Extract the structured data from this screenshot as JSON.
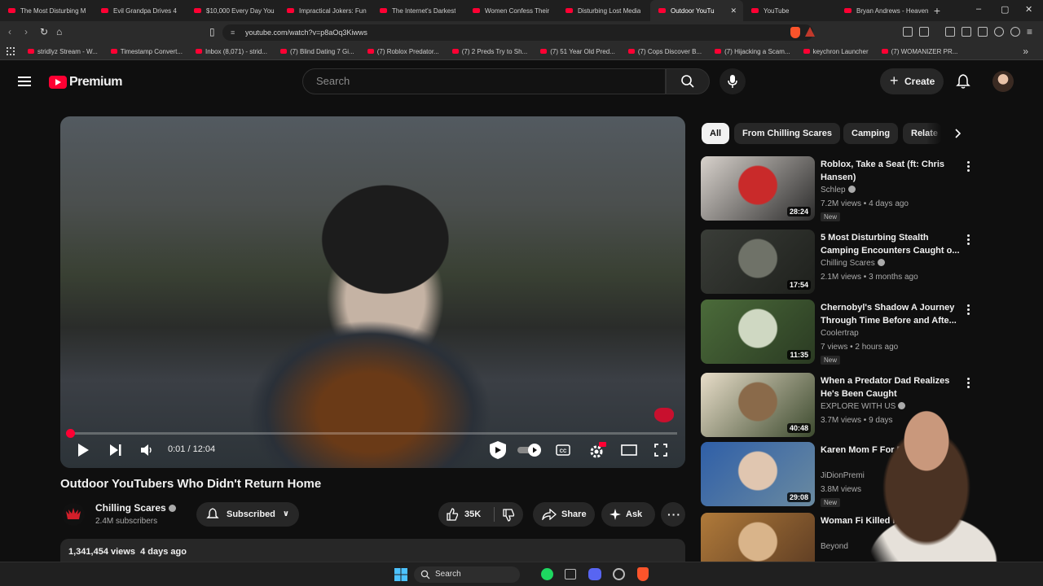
{
  "browser": {
    "tabs": [
      {
        "label": "The Most Disturbing M",
        "active": false
      },
      {
        "label": "Evil Grandpa Drives 4",
        "active": false
      },
      {
        "label": "$10,000 Every Day You",
        "active": false
      },
      {
        "label": "Impractical Jokers: Fun",
        "active": false
      },
      {
        "label": "The Internet's Darkest",
        "active": false
      },
      {
        "label": "Women Confess Their",
        "active": false
      },
      {
        "label": "Disturbing Lost Media",
        "active": false
      },
      {
        "label": "Outdoor YouTu",
        "active": true
      },
      {
        "label": "YouTube",
        "active": false
      },
      {
        "label": "Bryan Andrews - Heaven",
        "active": false
      }
    ],
    "url": "youtube.com/watch?v=p8aOq3Kiwws",
    "bookmarks": [
      "stridlyz Stream - W...",
      "Timestamp Convert...",
      "Inbox (8,071) - strid...",
      "(7) Blind Dating 7 Gi...",
      "(7) Roblox Predator...",
      "(7) 2 Preds Try to Sh...",
      "(7) 51 Year Old Pred...",
      "(7) Cops Discover B...",
      "(7) Hijacking a Scam...",
      "keychron Launcher",
      "(7) WOMANIZER PR..."
    ]
  },
  "header": {
    "logo_text": "Premium",
    "search_placeholder": "Search",
    "create_label": "Create"
  },
  "player": {
    "time": "0:01 / 12:04",
    "progress": 0.0014,
    "watermark_color": "#c8102e"
  },
  "video": {
    "title": "Outdoor YouTubers Who Didn't Return Home",
    "channel": "Chilling Scares",
    "subscribers": "2.4M subscribers",
    "subscribed_label": "Subscribed",
    "likes": "35K",
    "share_label": "Share",
    "ask_label": "Ask",
    "views": "1,341,454 views",
    "posted": "4 days ago"
  },
  "chips": [
    {
      "label": "All",
      "active": true
    },
    {
      "label": "From Chilling Scares",
      "active": false
    },
    {
      "label": "Camping",
      "active": false
    },
    {
      "label": "Relate",
      "active": false
    }
  ],
  "recommendations": [
    {
      "title": "Roblox, Take a Seat (ft: Chris Hansen)",
      "channel": "Schlep",
      "verified": true,
      "meta": "7.2M views • 4 days ago",
      "badge": "New",
      "duration": "28:24",
      "thumb_colors": [
        "#d8d2cc",
        "#c92a2a",
        "#2b2b2b"
      ]
    },
    {
      "title": "5 Most Disturbing Stealth Camping Encounters Caught o...",
      "channel": "Chilling Scares",
      "verified": true,
      "meta": "2.1M views • 3 months ago",
      "badge": "",
      "duration": "17:54",
      "thumb_colors": [
        "#3a3d38",
        "#6f7268",
        "#1e201c"
      ]
    },
    {
      "title": "Chernobyl's Shadow  A Journey Through Time Before and Afte...",
      "channel": "Coolertrap",
      "verified": false,
      "meta": "7 views • 2 hours ago",
      "badge": "New",
      "duration": "11:35",
      "thumb_colors": [
        "#4b6b3a",
        "#cfd8c2",
        "#2a3a22"
      ]
    },
    {
      "title": "When a Predator Dad Realizes He's Been Caught",
      "channel": "EXPLORE WITH US",
      "verified": true,
      "meta": "3.7M views • 9 days",
      "badge": "",
      "duration": "40:48",
      "thumb_colors": [
        "#e8ddc9",
        "#8a6a4a",
        "#3c4a2e"
      ]
    },
    {
      "title": "Karen Mom F For EXPOS",
      "channel": "JiDionPremi",
      "verified": false,
      "meta": "3.8M views",
      "badge": "New",
      "duration": "29:08",
      "thumb_colors": [
        "#2f5fa8",
        "#e0c6b0",
        "#6a8aa0"
      ]
    },
    {
      "title": "Woman Fi Killed H",
      "channel": "Beyond",
      "verified": false,
      "meta": "",
      "badge": "",
      "duration": "",
      "thumb_colors": [
        "#b07a3a",
        "#d9b48a",
        "#5a3a22"
      ]
    }
  ],
  "taskbar": {
    "search_label": "Search"
  }
}
